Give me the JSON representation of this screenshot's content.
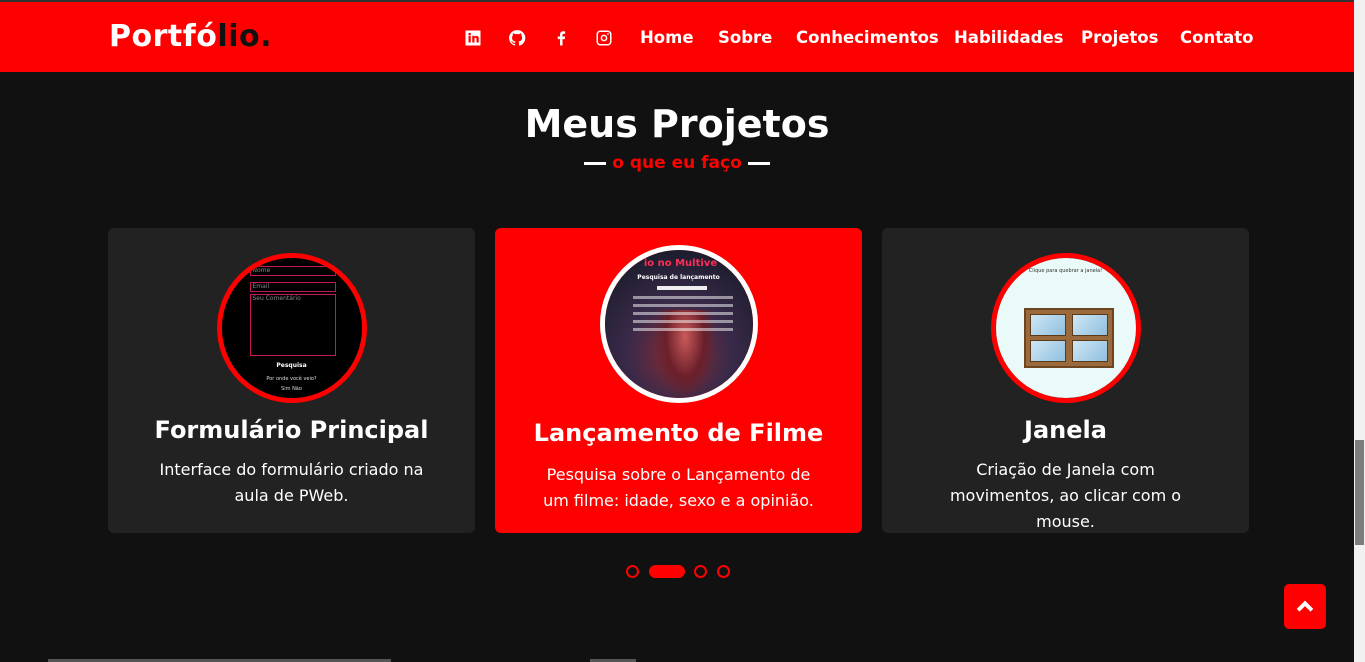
{
  "brand": {
    "logo_main": "Portfó",
    "logo_accent": "lio",
    "logo_dot": ".",
    "primary_color": "#ff0000",
    "background_color": "#111111",
    "card_color": "#222222"
  },
  "nav": {
    "icons": [
      "linkedin-icon",
      "github-icon",
      "facebook-icon",
      "instagram-icon"
    ],
    "links": [
      "Home",
      "Sobre",
      "Conhecimentos",
      "Habilidades",
      "Projetos",
      "Contato"
    ]
  },
  "section": {
    "title": "Meus Projetos",
    "subtitle": "o que eu faço"
  },
  "projects": [
    {
      "title": "Formulário Principal",
      "description": "Interface do formulário criado na aula de PWeb.",
      "thumb": {
        "field1": "Nome",
        "field2": "Email",
        "field3": "Seu Comentário",
        "heading": "Pesquisa",
        "question": "Por onde você veio?",
        "options": "Sim  Não"
      }
    },
    {
      "title": "Lançamento de Filme",
      "description": "Pesquisa sobre o Lançamento de um filme: idade, sexo e a opinião.",
      "thumb": {
        "heading": "io no Multive",
        "subheading": "Pesquisa de lançamento"
      }
    },
    {
      "title": "Janela",
      "description": "Criação de Janela com movimentos, ao clicar com o mouse.",
      "thumb": {
        "caption": "Clique para quebrar a janela!"
      }
    }
  ],
  "carousel": {
    "total_dots": 4,
    "active_index": 1
  }
}
